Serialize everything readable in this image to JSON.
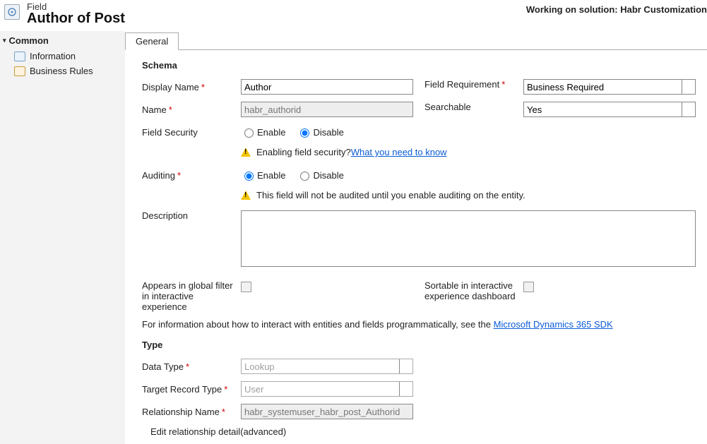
{
  "header": {
    "type_label": "Field",
    "title": "Author of Post",
    "solution_prefix": "Working on solution: ",
    "solution_name": "Habr Customization"
  },
  "nav": {
    "group": "Common",
    "items": [
      {
        "label": "Information"
      },
      {
        "label": "Business Rules"
      }
    ]
  },
  "tabs": {
    "general": "General"
  },
  "schema": {
    "title": "Schema",
    "display_name_label": "Display Name",
    "display_name_value": "Author",
    "name_label": "Name",
    "name_value": "habr_authorid",
    "field_req_label": "Field Requirement",
    "field_req_value": "Business Required",
    "searchable_label": "Searchable",
    "searchable_value": "Yes",
    "field_security_label": "Field Security",
    "enable": "Enable",
    "disable": "Disable",
    "security_note_prefix": "Enabling field security? ",
    "security_note_link": "What you need to know",
    "auditing_label": "Auditing",
    "auditing_note": "This field will not be audited until you enable auditing on the entity.",
    "description_label": "Description",
    "gfilter_label": "Appears in global filter in interactive experience",
    "sortable_label": "Sortable in interactive experience dashboard",
    "sdk_prefix": "For information about how to interact with entities and fields programmatically, see the ",
    "sdk_link": "Microsoft Dynamics 365 SDK"
  },
  "type": {
    "title": "Type",
    "data_type_label": "Data Type",
    "data_type_value": "Lookup",
    "target_label": "Target Record Type",
    "target_value": "User",
    "rel_name_label": "Relationship Name",
    "rel_name_value": "habr_systemuser_habr_post_Authorid",
    "advanced": "Edit relationship detail(advanced)"
  }
}
